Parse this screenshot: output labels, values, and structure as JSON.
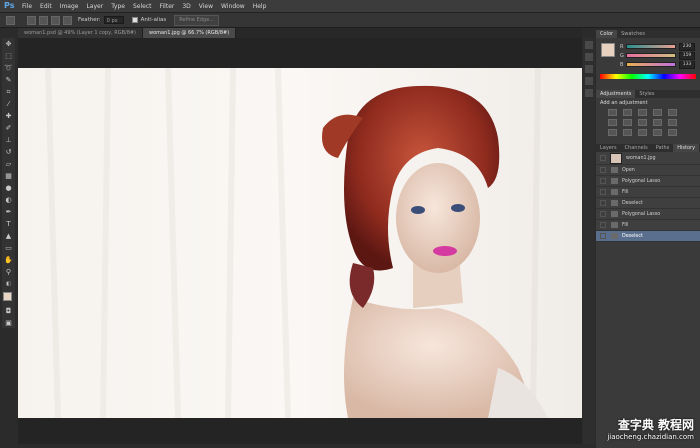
{
  "app": {
    "logo": "Ps"
  },
  "menu": [
    "File",
    "Edit",
    "Image",
    "Layer",
    "Type",
    "Select",
    "Filter",
    "3D",
    "View",
    "Window",
    "Help"
  ],
  "options": {
    "feather_label": "Feather:",
    "feather_value": "0 px",
    "antialias_label": "Anti-alias",
    "refine_button": "Refine Edge..."
  },
  "tabs": [
    {
      "label": "woman1.psd @ 49% (Layer 1 copy, RGB/8#)",
      "active": false
    },
    {
      "label": "woman1.jpg @ 66.7% (RGB/8#)",
      "active": true
    }
  ],
  "color_panel": {
    "tabs": [
      "Color",
      "Swatches"
    ],
    "r": "230",
    "g": "159",
    "b": "133",
    "swatch_fg": "#e8d2bf"
  },
  "adjustments": {
    "tabs": [
      "Adjustments",
      "Styles"
    ],
    "heading": "Add an adjustment"
  },
  "layers_tabs": [
    "Layers",
    "Channels",
    "Paths",
    "History"
  ],
  "history": {
    "snapshot": "woman1.jpg",
    "items": [
      "Open",
      "Polygonal Lasso",
      "Fill",
      "Deselect",
      "Polygonal Lasso",
      "Fill",
      "Deselect"
    ],
    "selected_index": 6
  },
  "watermark": {
    "line1": "查字典 教程网",
    "line2": "jiaocheng.chazidian.com"
  }
}
